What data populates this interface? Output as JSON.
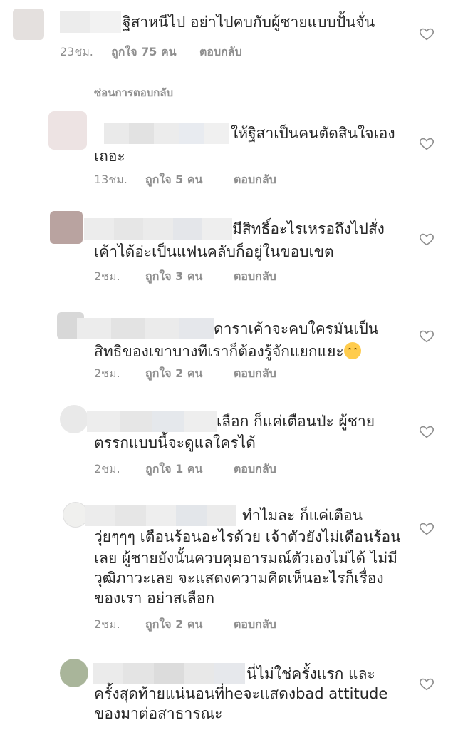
{
  "hide_replies": "ซ่อนการตอบกลับ",
  "comments": [
    {
      "lines": [
        "ฐิสาหนีไป อย่าไปคบกับผู้ชายแบบปั้นจั่น"
      ],
      "time": "23ชม.",
      "likes": "ถูกใจ 75 คน",
      "reply": "ตอบกลับ"
    },
    {
      "lines": [
        "ให้ฐิสาเป็นคนตัดสินใจเอง",
        "เถอะ"
      ],
      "time": "13ชม.",
      "likes": "ถูกใจ 5 คน",
      "reply": "ตอบกลับ"
    },
    {
      "lines": [
        "มีสิทธิ์อะไรเหรอถึงไปสั่ง",
        "เค้าได้อ่ะเป็นแฟนคลับก็อยู่ในขอบเขต"
      ],
      "time": "2ชม.",
      "likes": "ถูกใจ 3 คน",
      "reply": "ตอบกลับ"
    },
    {
      "lines": [
        "ดาราเค้าจะคบใครมันเป็น",
        "สิทธิของเขาบางทีเราก็ต้องรู้จักแยกแยะ"
      ],
      "time": "2ชม.",
      "likes": "ถูกใจ 2 คน",
      "reply": "ตอบกลับ"
    },
    {
      "lines": [
        "เลือก ก็แค่เตือนป่ะ ผู้ชาย",
        "ตรรกแบบนี้จะดูแลใครได้"
      ],
      "time": "2ชม.",
      "likes": "ถูกใจ 1 คน",
      "reply": "ตอบกลับ"
    },
    {
      "lines": [
        "ทำไมละ ก็แค่เตือน",
        "วุ่ยๆๆๆ เตือนร้อนอะไรด้วย เจ้าตัวยังไม่เดือนร้อน",
        "เลย ผู้ชายยังนั้นควบคุมอารมณ์ตัวเองไม่ได้ ไม่มี",
        "วุฒิภาวะเลย จะแสดงความคิดเห็นอะไรก็เรื่อง",
        "ของเรา อย่าสเลือก"
      ],
      "time": "2ชม.",
      "likes": "ถูกใจ 2 คน",
      "reply": "ตอบกลับ"
    },
    {
      "lines": [
        "นี่ไม่ใช่ครั้งแรก และ",
        "ครั้งสุดท้ายแน่นอนที่heจะแสดงbad attitude",
        "ของมาต่อสาธารณะ"
      ],
      "time": "",
      "likes": "",
      "reply": ""
    }
  ]
}
